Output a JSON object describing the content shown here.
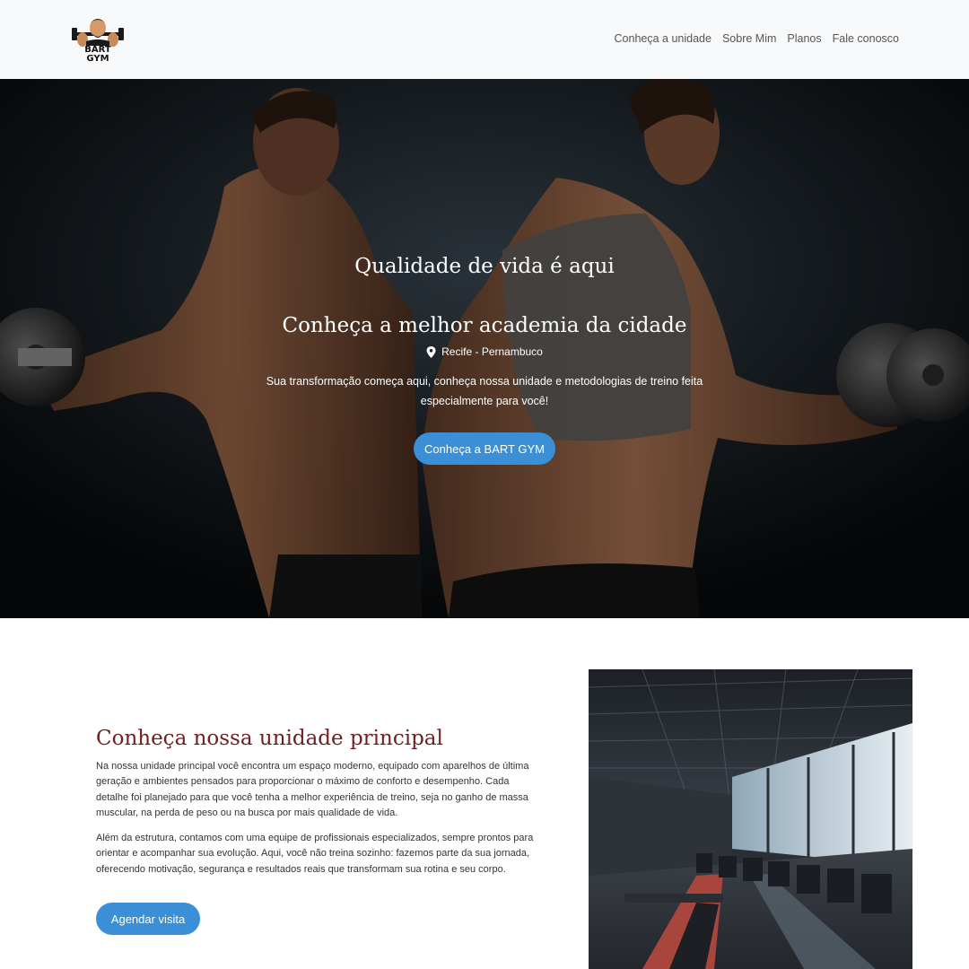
{
  "brand": {
    "logo_line1": "BART",
    "logo_line2": "GYM"
  },
  "nav": {
    "items": [
      {
        "label": "Conheça a unidade"
      },
      {
        "label": "Sobre Mim"
      },
      {
        "label": "Planos"
      },
      {
        "label": "Fale conosco"
      }
    ]
  },
  "hero": {
    "title": "Qualidade de vida é aqui",
    "subtitle": "Conheça a melhor academia da cidade",
    "location": "Recife - Pernambuco",
    "description": "Sua transformação começa aqui, conheça nossa unidade e metodologias de treino feita especialmente para você!",
    "cta_label": "Conheça a BART GYM"
  },
  "about": {
    "title": "Conheça nossa unidade principal",
    "paragraph1": "Na nossa unidade principal você encontra um espaço moderno, equipado com aparelhos de última geração e ambientes pensados para proporcionar o máximo de conforto e desempenho. Cada detalhe foi planejado para que você tenha a melhor experiência de treino, seja no ganho de massa muscular, na perda de peso ou na busca por mais qualidade de vida.",
    "paragraph2": "Além da estrutura, contamos com uma equipe de profissionais especializados, sempre prontos para orientar e acompanhar sua evolução. Aqui, você não treina sozinho: fazemos parte da sua jornada, oferecendo motivação, segurança e resultados reais que transformam sua rotina e seu corpo.",
    "cta_label": "Agendar visita"
  },
  "colors": {
    "navbar_bg": "#f8f9fa",
    "accent_button": "#3a8fd6",
    "section_title": "#6e1f1f"
  },
  "icons": {
    "location": "map-pin-icon",
    "logo": "bearded-man-logo-icon"
  }
}
